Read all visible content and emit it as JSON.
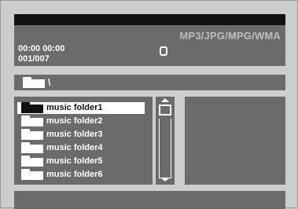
{
  "header": {
    "format_label": "MP3/JPG/MPG/WMA",
    "time": "00:00  00:00",
    "track_count": "001/007",
    "stop_icon": "stop-icon"
  },
  "path": {
    "text": "\\",
    "icon": "folder-icon"
  },
  "file_list": {
    "items": [
      {
        "label": "music folder1",
        "selected": true
      },
      {
        "label": "music folder2",
        "selected": false
      },
      {
        "label": "music folder3",
        "selected": false
      },
      {
        "label": "music folder4",
        "selected": false
      },
      {
        "label": "music folder5",
        "selected": false
      },
      {
        "label": "music folder6",
        "selected": false
      }
    ]
  },
  "colors": {
    "panel": "#6b6b6b",
    "background": "#cdcdcd",
    "topbar": "#111111",
    "text": "#ffffff"
  }
}
